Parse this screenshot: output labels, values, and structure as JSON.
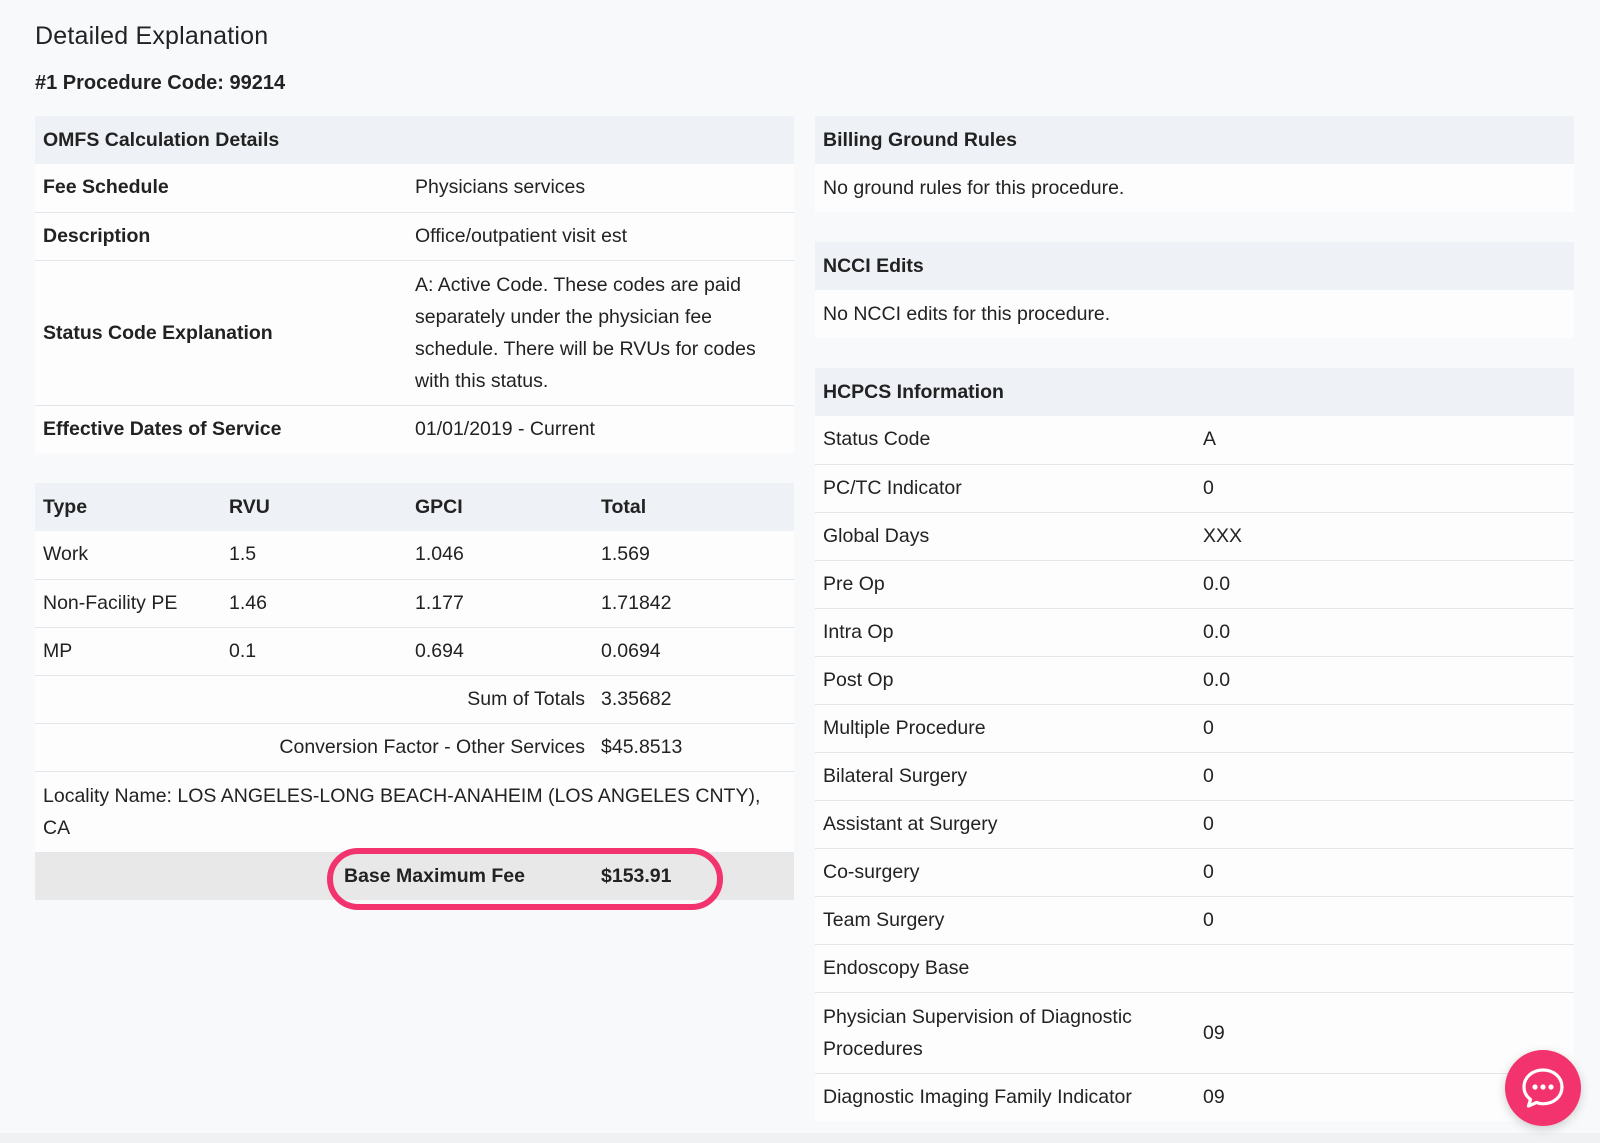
{
  "page": {
    "title": "Detailed Explanation",
    "procedure_code": "#1 Procedure Code: 99214"
  },
  "omfs": {
    "header": "OMFS Calculation Details",
    "rows": [
      {
        "label": "Fee Schedule",
        "value": "Physicians services"
      },
      {
        "label": "Description",
        "value": "Office/outpatient visit est"
      },
      {
        "label": "Status Code Explanation",
        "value": "A: Active Code. These codes are paid separately under the physician fee schedule. There will be RVUs for codes with this status."
      },
      {
        "label": "Effective Dates of Service",
        "value": "01/01/2019 - Current"
      }
    ]
  },
  "rvu_table": {
    "headers": [
      "Type",
      "RVU",
      "GPCI",
      "Total"
    ],
    "rows": [
      [
        "Work",
        "1.5",
        "1.046",
        "1.569"
      ],
      [
        "Non-Facility PE",
        "1.46",
        "1.177",
        "1.71842"
      ],
      [
        "MP",
        "0.1",
        "0.694",
        "0.0694"
      ]
    ],
    "sum_label": "Sum of Totals",
    "sum_value": "3.35682",
    "conversion_label": "Conversion Factor - Other Services",
    "conversion_value": "$45.8513",
    "locality": "Locality Name: LOS ANGELES-LONG BEACH-ANAHEIM (LOS ANGELES CNTY), CA",
    "base_fee_label": "Base Maximum Fee",
    "base_fee_value": "$153.91"
  },
  "billing": {
    "header": "Billing Ground Rules",
    "text": "No ground rules for this procedure."
  },
  "ncci": {
    "header": "NCCI Edits",
    "text": "No NCCI edits for this procedure."
  },
  "hcpcs": {
    "header": "HCPCS Information",
    "rows": [
      {
        "label": "Status Code",
        "value": "A"
      },
      {
        "label": "PC/TC Indicator",
        "value": "0"
      },
      {
        "label": "Global Days",
        "value": "XXX"
      },
      {
        "label": "Pre Op",
        "value": "0.0"
      },
      {
        "label": "Intra Op",
        "value": "0.0"
      },
      {
        "label": "Post Op",
        "value": "0.0"
      },
      {
        "label": "Multiple Procedure",
        "value": "0"
      },
      {
        "label": "Bilateral Surgery",
        "value": "0"
      },
      {
        "label": "Assistant at Surgery",
        "value": "0"
      },
      {
        "label": "Co-surgery",
        "value": "0"
      },
      {
        "label": "Team Surgery",
        "value": "0"
      },
      {
        "label": "Endoscopy Base",
        "value": ""
      },
      {
        "label": "Physician Supervision of Diagnostic Procedures",
        "value": "09"
      },
      {
        "label": "Diagnostic Imaging Family Indicator",
        "value": "09"
      }
    ]
  },
  "colors": {
    "accent": "#f2336d",
    "header_bg": "#eef1f5",
    "base_fee_bg": "#e8e8e8"
  },
  "icons": {
    "chat": "chat-bubble-icon"
  }
}
